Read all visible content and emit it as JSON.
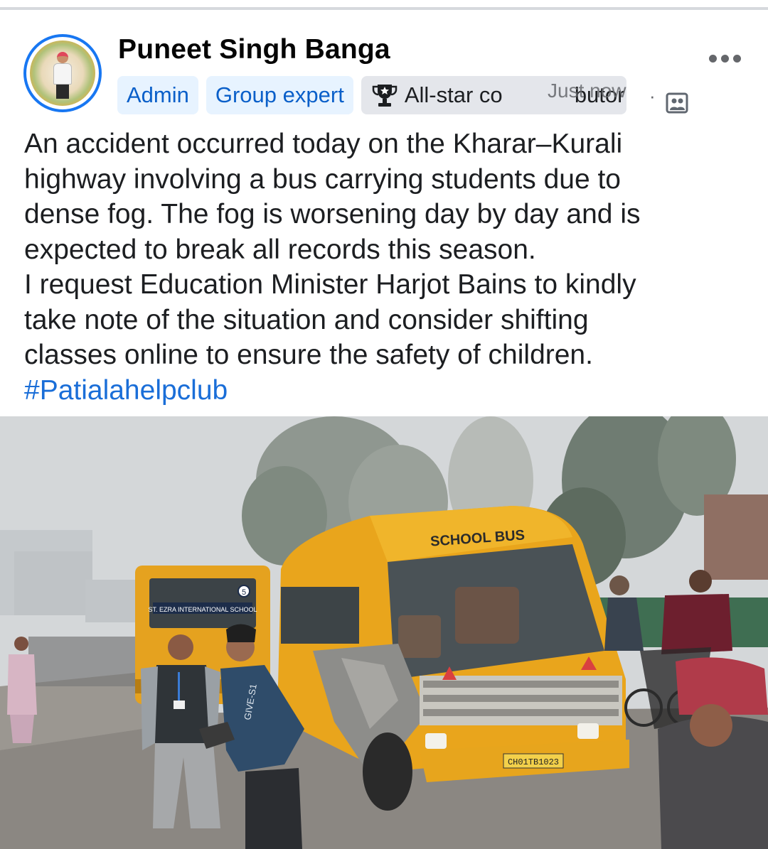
{
  "post": {
    "author_name": "Puneet Singh Banga",
    "badges": [
      "Admin",
      "Group expert"
    ],
    "allstar_badge": "All-star co",
    "allstar_badge_tail": "butor",
    "timestamp": "Just now",
    "separator": "·",
    "body_lines": [
      "An accident occurred today on the Kharar–Kurali",
      "highway involving a bus carrying students due to",
      "dense fog. The fog is worsening day by day and is",
      "expected to break all records this season.",
      "I request Education Minister Harjot Bains to kindly",
      "take note of the situation and consider shifting",
      "classes online to ensure the safety of children."
    ],
    "hashtag": "#Patialahelpclub"
  },
  "photo": {
    "bus_front_label": "SCHOOL BUS",
    "bus_plate": "CH01TB1023",
    "rear_bus_label": "ST. EZRA INTERNATIONAL SCHOOL",
    "rear_bus_route": "5",
    "shirt_text": "GIVE-S1"
  },
  "icons": {
    "more": "more-options-icon",
    "trophy": "trophy-icon",
    "audience": "group-audience-icon"
  },
  "colors": {
    "accent_blue": "#1877f2",
    "badge_blue_bg": "#e7f3ff",
    "badge_blue_text": "#0a5fc9",
    "hashtag": "#1a6ed8",
    "bus_yellow": "#e9a51c"
  }
}
